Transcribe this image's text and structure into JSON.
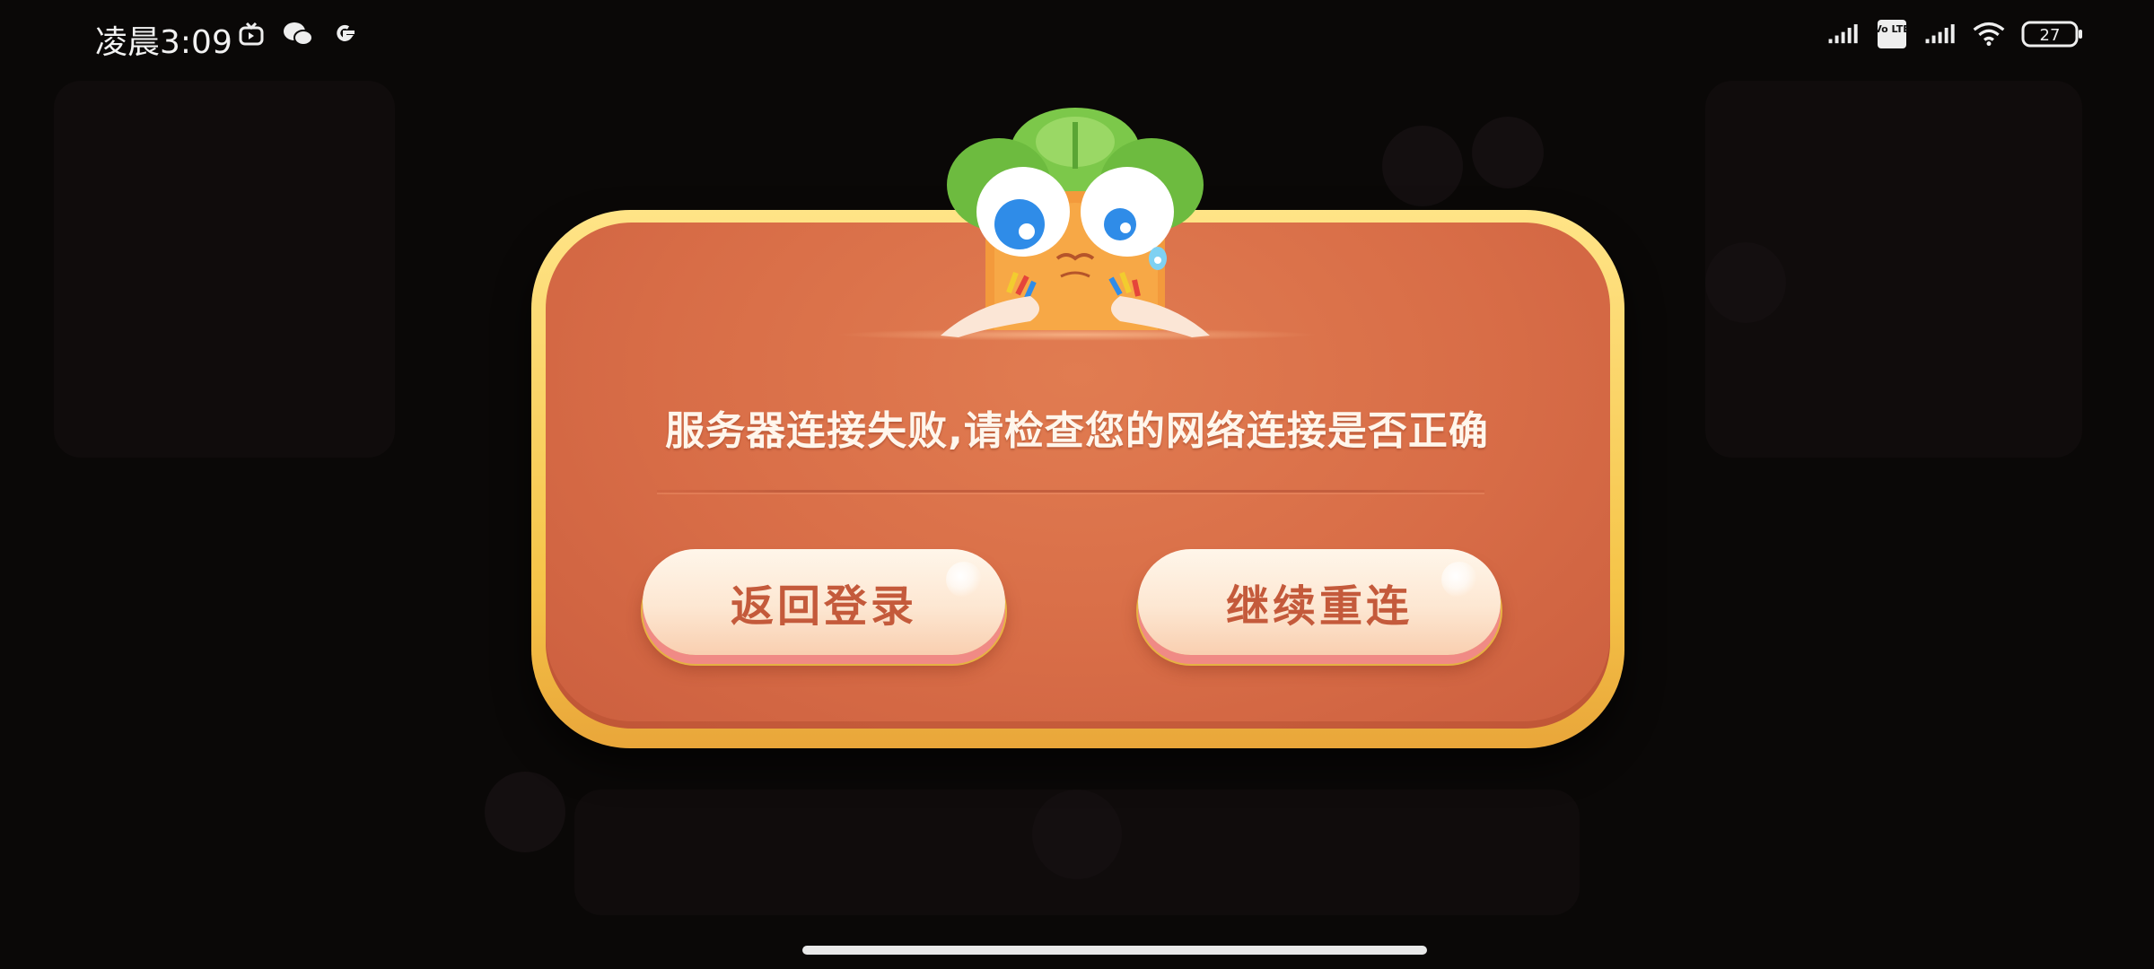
{
  "status_bar": {
    "time": "凌晨3:09",
    "left_icons": [
      "tv-app-icon",
      "wechat-icon",
      "google-icon"
    ],
    "right_icons": [
      "signal-icon",
      "volte-icon",
      "signal-icon",
      "wifi-icon",
      "battery-icon"
    ],
    "volte_label": "Vo LTE",
    "battery_level": "27"
  },
  "dialog": {
    "message": "服务器连接失败,请检查您的网络连接是否正确",
    "buttons": {
      "back_to_login": "返回登录",
      "reconnect": "继续重连"
    },
    "mascot_icon": "carrot-mascot-icon"
  },
  "colors": {
    "dialog_border": "#f5c448",
    "dialog_fill": "#d86d47",
    "button_fill": "#fde7d2",
    "button_text": "#c45a3b",
    "message_text": "#fff6ec"
  }
}
